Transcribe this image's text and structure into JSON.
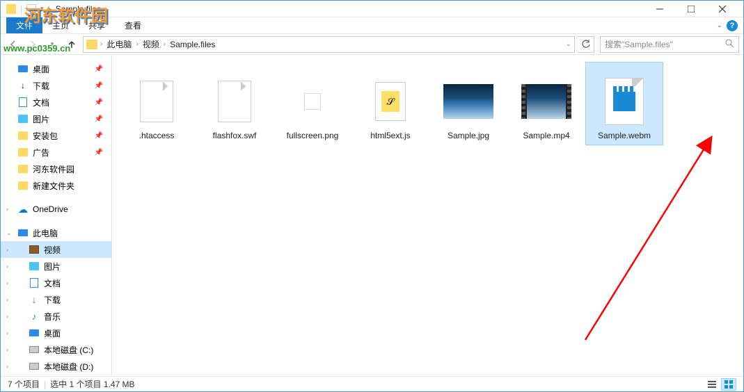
{
  "window": {
    "title": "Sample.files"
  },
  "ribbon": {
    "file": "文件",
    "home": "主页",
    "share": "共享",
    "view": "查看"
  },
  "breadcrumb": {
    "root_icon": "folder",
    "items": [
      "此电脑",
      "视频",
      "Sample.files"
    ]
  },
  "search": {
    "placeholder": "搜索\"Sample.files\""
  },
  "sidebar": {
    "quick_access": [
      {
        "label": "桌面",
        "icon": "desktop",
        "pinned": true
      },
      {
        "label": "下载",
        "icon": "download",
        "pinned": true
      },
      {
        "label": "文档",
        "icon": "doc",
        "pinned": true
      },
      {
        "label": "图片",
        "icon": "pic",
        "pinned": true
      },
      {
        "label": "安装包",
        "icon": "folder",
        "pinned": true
      },
      {
        "label": "广告",
        "icon": "folder",
        "pinned": true
      },
      {
        "label": "河东软件园",
        "icon": "folder",
        "pinned": false
      },
      {
        "label": "新建文件夹",
        "icon": "folder",
        "pinned": false
      }
    ],
    "onedrive": {
      "label": "OneDrive"
    },
    "thispc": {
      "label": "此电脑",
      "children": [
        {
          "label": "视频",
          "icon": "video",
          "active": true
        },
        {
          "label": "图片",
          "icon": "pic"
        },
        {
          "label": "文档",
          "icon": "doc"
        },
        {
          "label": "下载",
          "icon": "download"
        },
        {
          "label": "音乐",
          "icon": "music"
        },
        {
          "label": "桌面",
          "icon": "desktop"
        },
        {
          "label": "本地磁盘 (C:)",
          "icon": "drive"
        },
        {
          "label": "本地磁盘 (D:)",
          "icon": "drive"
        }
      ]
    }
  },
  "files": [
    {
      "name": ".htaccess",
      "type": "blank"
    },
    {
      "name": "flashfox.swf",
      "type": "blank"
    },
    {
      "name": "fullscreen.png",
      "type": "png-small"
    },
    {
      "name": "html5ext.js",
      "type": "js"
    },
    {
      "name": "Sample.jpg",
      "type": "image"
    },
    {
      "name": "Sample.mp4",
      "type": "video"
    },
    {
      "name": "Sample.webm",
      "type": "webm",
      "selected": true
    }
  ],
  "statusbar": {
    "count": "7 个项目",
    "selection": "选中 1 个项目  1.47 MB"
  },
  "watermark": {
    "text": "河东软件园",
    "url": "www.pc0359.cn"
  }
}
